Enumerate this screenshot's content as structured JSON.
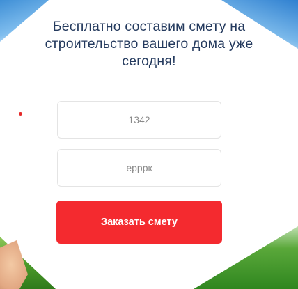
{
  "form": {
    "heading": "Бесплатно составим смету на строительство вашего дома уже сегодня!",
    "fields": [
      {
        "value": "1342"
      },
      {
        "value": "ерррк"
      }
    ],
    "submit_label": "Заказать смету"
  },
  "colors": {
    "accent": "#f42a2f",
    "heading_text": "#243a5e",
    "field_border": "#e4e4e4"
  }
}
